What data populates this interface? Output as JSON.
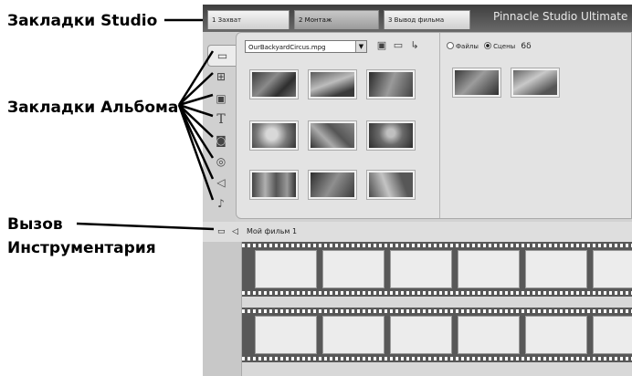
{
  "annotations": {
    "studio_tabs": "Закладки Studio",
    "album_tabs": "Закладки Альбома",
    "toolbox_line1": "Вызов",
    "toolbox_line2": "Инструментария"
  },
  "app": {
    "title": "Pinnacle Studio Ultimate",
    "tabs": [
      {
        "label": "1 Захват",
        "active": false
      },
      {
        "label": "2 Монтаж",
        "active": true
      },
      {
        "label": "3 Вывод фильма",
        "active": false
      }
    ]
  },
  "album": {
    "tab_icons": [
      "video-icon",
      "transitions-icon",
      "photo-icon",
      "title-icon",
      "still-image-icon",
      "disc-menu-icon",
      "sound-effects-icon",
      "music-icon"
    ],
    "tab_glyphs": [
      "▭",
      "⊞",
      "▣",
      "T",
      "◙",
      "◎",
      "◁",
      "♪"
    ],
    "file_select": {
      "value": "OurBackyardCircus.mpg"
    },
    "view_options": {
      "files_label": "Файлы",
      "scenes_label": "Сцены",
      "glasses_glyph": "6δ",
      "selected": "Сцены"
    },
    "colors": {
      "panel": "#e3e3e3",
      "film": "#585858"
    }
  },
  "timeline": {
    "movie_title": "Мой фильм 1"
  }
}
